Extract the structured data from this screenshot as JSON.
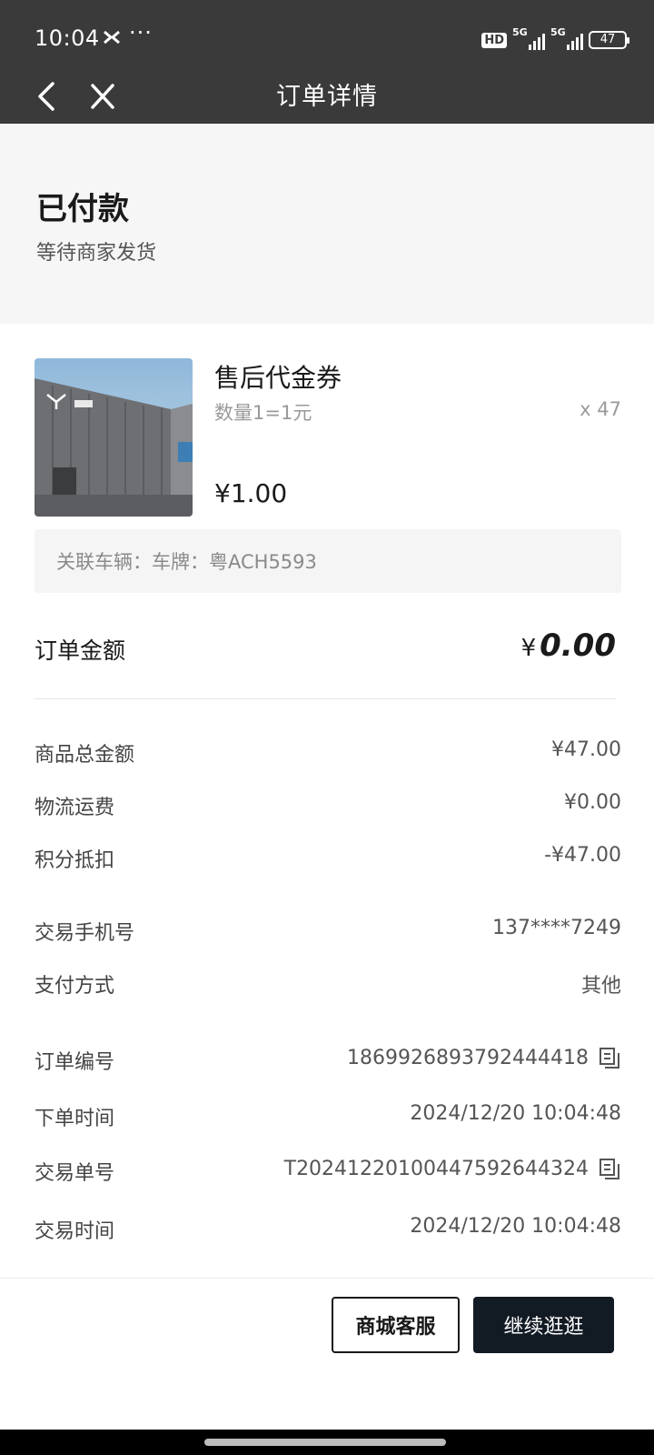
{
  "status_bar": {
    "time": "10:04",
    "more": "···",
    "hd_badge": "HD",
    "signal_1": "5G",
    "signal_2": "5G",
    "battery": "47"
  },
  "nav": {
    "title": "订单详情",
    "back_icon": "chevron-left-icon",
    "close_icon": "close-icon"
  },
  "order_status": {
    "title": "已付款",
    "subtitle": "等待商家发货"
  },
  "product": {
    "name": "售后代金券",
    "spec": "数量1=1元",
    "quantity": "x 47",
    "price": "¥1.00"
  },
  "vehicle": {
    "text": "关联车辆：车牌：粤ACH5593"
  },
  "order_amount": {
    "label": "订单金额",
    "currency": "¥",
    "value": "0.00"
  },
  "details": [
    {
      "label": "商品总金额",
      "value": "¥47.00"
    },
    {
      "label": "物流运费",
      "value": "¥0.00"
    },
    {
      "label": "积分抵扣",
      "value": "-¥47.00"
    },
    {
      "label": "交易手机号",
      "value": "137****7249"
    },
    {
      "label": "支付方式",
      "value": "其他"
    },
    {
      "label": "订单编号",
      "value": "1869926893792444418"
    },
    {
      "label": "下单时间",
      "value": "2024/12/20 10:04:48"
    },
    {
      "label": "交易单号",
      "value": "T2024122010044759264432​4"
    },
    {
      "label": "交易时间",
      "value": "2024/12/20 10:04:48"
    }
  ],
  "buttons": {
    "service": "商城客服",
    "continue": "继续逛逛"
  },
  "colors": {
    "header_bg": "#3a3a3a",
    "primary_button": "#121a24",
    "muted_text": "#9a9a9a"
  }
}
